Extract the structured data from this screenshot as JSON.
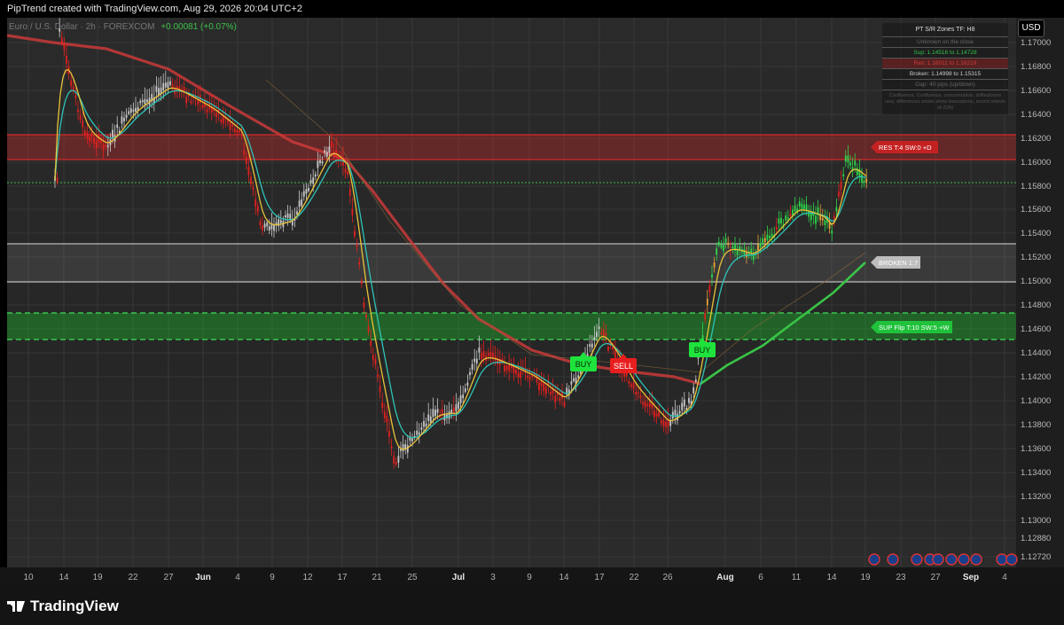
{
  "header": {
    "caption": "PipTrend created with TradingView.com, Aug 29, 2026 20:04 UTC+2"
  },
  "legend": {
    "symbol": "Euro / U.S. Dollar · 2h · FOREXCOM",
    "change": "+0.00081 (+0.07%)"
  },
  "price_axis": {
    "currency_button": "USD",
    "labels": [
      "1.17000",
      "1.16800",
      "1.16600",
      "1.16400",
      "1.16200",
      "1.16000",
      "1.15800",
      "1.15600",
      "1.15400",
      "1.15200",
      "1.15000",
      "1.14800",
      "1.14600",
      "1.14400",
      "1.14200",
      "1.14000",
      "1.13800",
      "1.13600",
      "1.13400",
      "1.13200",
      "1.13000",
      "1.12880",
      "1.12720"
    ]
  },
  "time_axis": {
    "labels": [
      "10",
      "14",
      "19",
      "22",
      "27",
      "Jun",
      "4",
      "9",
      "12",
      "17",
      "21",
      "25",
      "Jul",
      "3",
      "9",
      "14",
      "17",
      "22",
      "26",
      "Aug",
      "6",
      "11",
      "14",
      "19",
      "23",
      "27",
      "Sep",
      "4"
    ]
  },
  "info_panel": {
    "title": "PT S/R Zones  TF: H8",
    "line1": "Unknown on the close",
    "line2": "Sup: 1.14516 to 1.14728",
    "line3": "Res: 1.16011 to 1.16219",
    "line4": "Broken: 1.14998 to 1.15315",
    "line5": "Gap: 40 pips (up/down)",
    "note": "Confluence, Confluence, concentration, drifted/zone new, differences zones show innovations, recent retests of ZON"
  },
  "zone_tags": {
    "res": "RES  T:4 SW:0 +D",
    "broken": "BROKEN  1:7",
    "sup": "SUP Flip  T:10 SW:5 +W"
  },
  "signals": [
    {
      "label": "BUY",
      "type": "buy"
    },
    {
      "label": "SELL",
      "type": "sell"
    },
    {
      "label": "BUY",
      "type": "buy"
    }
  ],
  "footer": {
    "brand": "TradingView"
  },
  "colors": {
    "res_zone": "#d42a2a",
    "sup_zone": "#1f9e2c",
    "broken_zone": "#9a9a9a",
    "bull": "#2fd64a",
    "bear": "#e0201e",
    "neutral": "#c8c8c8",
    "ema_fast": "#e8c33a",
    "ema_mid": "#2ec4b6",
    "ma_slow": "#c93a3a",
    "ma_slow_up": "#39c447"
  },
  "chart_data": {
    "type": "candlestick",
    "symbol": "EURUSD",
    "ylim": [
      1.1266,
      1.1712
    ],
    "zones": [
      {
        "kind": "resistance",
        "from": 1.16011,
        "to": 1.16219
      },
      {
        "kind": "broken",
        "from": 1.14998,
        "to": 1.15315
      },
      {
        "kind": "support",
        "from": 1.14516,
        "to": 1.14728
      }
    ],
    "current_price": 1.1582,
    "price_path_approx": [
      {
        "t": "May 12",
        "price": 1.171
      },
      {
        "t": "May 16",
        "price": 1.162
      },
      {
        "t": "May 20",
        "price": 1.161
      },
      {
        "t": "May 22",
        "price": 1.164
      },
      {
        "t": "May 27",
        "price": 1.166
      },
      {
        "t": "Jun 2",
        "price": 1.164
      },
      {
        "t": "Jun 6",
        "price": 1.162
      },
      {
        "t": "Jun 8",
        "price": 1.154
      },
      {
        "t": "Jun 12",
        "price": 1.155
      },
      {
        "t": "Jun 16",
        "price": 1.161
      },
      {
        "t": "Jun 18",
        "price": 1.159
      },
      {
        "t": "Jun 20",
        "price": 1.147
      },
      {
        "t": "Jun 24",
        "price": 1.135
      },
      {
        "t": "Jun 27",
        "price": 1.139
      },
      {
        "t": "Jul 1",
        "price": 1.139
      },
      {
        "t": "Jul 3",
        "price": 1.144
      },
      {
        "t": "Jul 9",
        "price": 1.142
      },
      {
        "t": "Jul 14",
        "price": 1.14
      },
      {
        "t": "Jul 17",
        "price": 1.146
      },
      {
        "t": "Jul 22",
        "price": 1.141
      },
      {
        "t": "Jul 26",
        "price": 1.138
      },
      {
        "t": "Jul 30",
        "price": 1.14
      },
      {
        "t": "Aug 1",
        "price": 1.153
      },
      {
        "t": "Aug 4",
        "price": 1.152
      },
      {
        "t": "Aug 8",
        "price": 1.156
      },
      {
        "t": "Aug 11",
        "price": 1.155
      },
      {
        "t": "Aug 14",
        "price": 1.154
      },
      {
        "t": "Aug 16",
        "price": 1.16
      },
      {
        "t": "Aug 19",
        "price": 1.1582
      }
    ]
  }
}
